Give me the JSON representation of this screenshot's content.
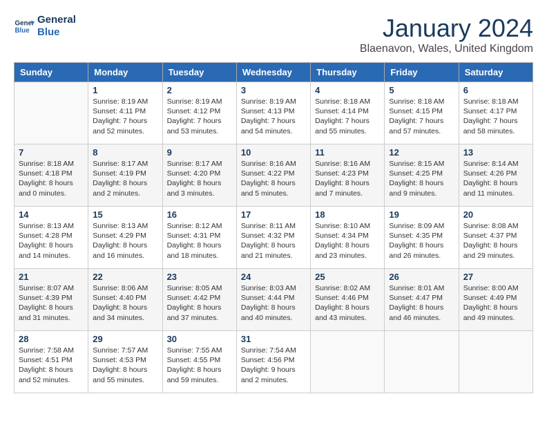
{
  "header": {
    "logo_line1": "General",
    "logo_line2": "Blue",
    "title": "January 2024",
    "subtitle": "Blaenavon, Wales, United Kingdom"
  },
  "days_of_week": [
    "Sunday",
    "Monday",
    "Tuesday",
    "Wednesday",
    "Thursday",
    "Friday",
    "Saturday"
  ],
  "weeks": [
    [
      {
        "day": "",
        "content": ""
      },
      {
        "day": "1",
        "content": "Sunrise: 8:19 AM\nSunset: 4:11 PM\nDaylight: 7 hours\nand 52 minutes."
      },
      {
        "day": "2",
        "content": "Sunrise: 8:19 AM\nSunset: 4:12 PM\nDaylight: 7 hours\nand 53 minutes."
      },
      {
        "day": "3",
        "content": "Sunrise: 8:19 AM\nSunset: 4:13 PM\nDaylight: 7 hours\nand 54 minutes."
      },
      {
        "day": "4",
        "content": "Sunrise: 8:18 AM\nSunset: 4:14 PM\nDaylight: 7 hours\nand 55 minutes."
      },
      {
        "day": "5",
        "content": "Sunrise: 8:18 AM\nSunset: 4:15 PM\nDaylight: 7 hours\nand 57 minutes."
      },
      {
        "day": "6",
        "content": "Sunrise: 8:18 AM\nSunset: 4:17 PM\nDaylight: 7 hours\nand 58 minutes."
      }
    ],
    [
      {
        "day": "7",
        "content": "Sunrise: 8:18 AM\nSunset: 4:18 PM\nDaylight: 8 hours\nand 0 minutes."
      },
      {
        "day": "8",
        "content": "Sunrise: 8:17 AM\nSunset: 4:19 PM\nDaylight: 8 hours\nand 2 minutes."
      },
      {
        "day": "9",
        "content": "Sunrise: 8:17 AM\nSunset: 4:20 PM\nDaylight: 8 hours\nand 3 minutes."
      },
      {
        "day": "10",
        "content": "Sunrise: 8:16 AM\nSunset: 4:22 PM\nDaylight: 8 hours\nand 5 minutes."
      },
      {
        "day": "11",
        "content": "Sunrise: 8:16 AM\nSunset: 4:23 PM\nDaylight: 8 hours\nand 7 minutes."
      },
      {
        "day": "12",
        "content": "Sunrise: 8:15 AM\nSunset: 4:25 PM\nDaylight: 8 hours\nand 9 minutes."
      },
      {
        "day": "13",
        "content": "Sunrise: 8:14 AM\nSunset: 4:26 PM\nDaylight: 8 hours\nand 11 minutes."
      }
    ],
    [
      {
        "day": "14",
        "content": "Sunrise: 8:13 AM\nSunset: 4:28 PM\nDaylight: 8 hours\nand 14 minutes."
      },
      {
        "day": "15",
        "content": "Sunrise: 8:13 AM\nSunset: 4:29 PM\nDaylight: 8 hours\nand 16 minutes."
      },
      {
        "day": "16",
        "content": "Sunrise: 8:12 AM\nSunset: 4:31 PM\nDaylight: 8 hours\nand 18 minutes."
      },
      {
        "day": "17",
        "content": "Sunrise: 8:11 AM\nSunset: 4:32 PM\nDaylight: 8 hours\nand 21 minutes."
      },
      {
        "day": "18",
        "content": "Sunrise: 8:10 AM\nSunset: 4:34 PM\nDaylight: 8 hours\nand 23 minutes."
      },
      {
        "day": "19",
        "content": "Sunrise: 8:09 AM\nSunset: 4:35 PM\nDaylight: 8 hours\nand 26 minutes."
      },
      {
        "day": "20",
        "content": "Sunrise: 8:08 AM\nSunset: 4:37 PM\nDaylight: 8 hours\nand 29 minutes."
      }
    ],
    [
      {
        "day": "21",
        "content": "Sunrise: 8:07 AM\nSunset: 4:39 PM\nDaylight: 8 hours\nand 31 minutes."
      },
      {
        "day": "22",
        "content": "Sunrise: 8:06 AM\nSunset: 4:40 PM\nDaylight: 8 hours\nand 34 minutes."
      },
      {
        "day": "23",
        "content": "Sunrise: 8:05 AM\nSunset: 4:42 PM\nDaylight: 8 hours\nand 37 minutes."
      },
      {
        "day": "24",
        "content": "Sunrise: 8:03 AM\nSunset: 4:44 PM\nDaylight: 8 hours\nand 40 minutes."
      },
      {
        "day": "25",
        "content": "Sunrise: 8:02 AM\nSunset: 4:46 PM\nDaylight: 8 hours\nand 43 minutes."
      },
      {
        "day": "26",
        "content": "Sunrise: 8:01 AM\nSunset: 4:47 PM\nDaylight: 8 hours\nand 46 minutes."
      },
      {
        "day": "27",
        "content": "Sunrise: 8:00 AM\nSunset: 4:49 PM\nDaylight: 8 hours\nand 49 minutes."
      }
    ],
    [
      {
        "day": "28",
        "content": "Sunrise: 7:58 AM\nSunset: 4:51 PM\nDaylight: 8 hours\nand 52 minutes."
      },
      {
        "day": "29",
        "content": "Sunrise: 7:57 AM\nSunset: 4:53 PM\nDaylight: 8 hours\nand 55 minutes."
      },
      {
        "day": "30",
        "content": "Sunrise: 7:55 AM\nSunset: 4:55 PM\nDaylight: 8 hours\nand 59 minutes."
      },
      {
        "day": "31",
        "content": "Sunrise: 7:54 AM\nSunset: 4:56 PM\nDaylight: 9 hours\nand 2 minutes."
      },
      {
        "day": "",
        "content": ""
      },
      {
        "day": "",
        "content": ""
      },
      {
        "day": "",
        "content": ""
      }
    ]
  ]
}
